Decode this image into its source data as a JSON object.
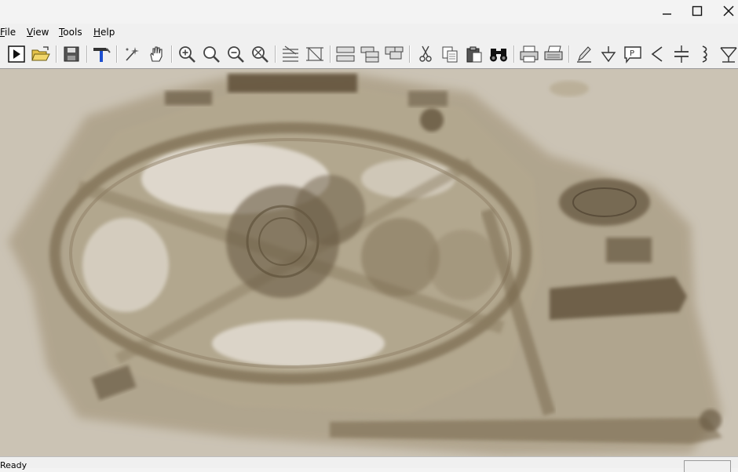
{
  "window": {
    "controls": [
      {
        "name": "minimize-icon"
      },
      {
        "name": "maximize-icon"
      },
      {
        "name": "close-icon"
      }
    ]
  },
  "menu": {
    "items": [
      {
        "mnemonic": "F",
        "rest": "ile"
      },
      {
        "mnemonic": "V",
        "rest": "iew"
      },
      {
        "mnemonic": "T",
        "rest": "ools"
      },
      {
        "mnemonic": "H",
        "rest": "elp"
      }
    ]
  },
  "toolbar": {
    "icons": [
      "run-icon",
      "open-folder-icon",
      "save-icon",
      "build-hammer-icon",
      "wand-icon",
      "pan-hand-icon",
      "zoom-in-icon",
      "zoom-icon",
      "zoom-out-icon",
      "zoom-fit-icon",
      "grid-align-icon",
      "frame-icon",
      "layout-rows-icon",
      "layout-stack-icon",
      "layout-cascade-icon",
      "cut-icon",
      "copy-icon",
      "paste-icon",
      "find-binoculars-icon",
      "print-icon",
      "print-setup-icon",
      "pencil-icon",
      "ground-icon",
      "probe-icon",
      "less-than-icon",
      "capacitor-icon",
      "inductor-icon",
      "transistor-icon"
    ]
  },
  "status": {
    "text": "Ready"
  },
  "colors": {
    "chrome": "#f0f0f0",
    "viewport_bg": "#cbc3b4",
    "artifact_dark": "#6b5c44",
    "artifact_mid": "#9d8f76",
    "artifact_light": "#e3ddd3"
  }
}
